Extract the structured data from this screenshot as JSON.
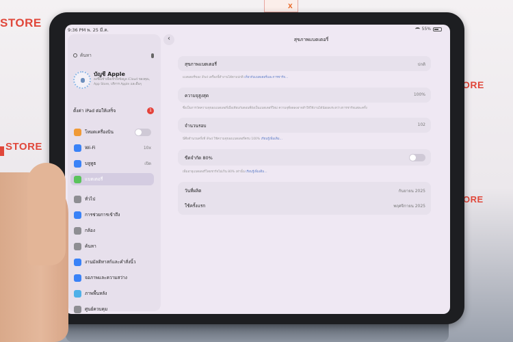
{
  "background": {
    "store_text_1": "STORE",
    "store_text_2": "STORE",
    "store_text_3": "ORE",
    "store_text_4": "ORE",
    "logo_letter": "x"
  },
  "status_bar": {
    "time": "9:36 PM  พ. 25 มี.ค.",
    "battery": "55%"
  },
  "sidebar": {
    "search_placeholder": "ค้นหา",
    "account": {
      "name": "บัญชี Apple",
      "subtitle": "ลงชื่อเข้าเพื่อเข้าถึงข้อมูล iCloud ของคุณ, App Store, บริการ Apple และอื่นๆ"
    },
    "finish_setup": {
      "label": "ตั้งค่า iPad ต่อให้เสร็จ",
      "badge": "1"
    },
    "items": [
      {
        "label": "โหมดเครื่องบิน",
        "value": "",
        "color": "#f09a37",
        "toggle": true
      },
      {
        "label": "Wi-Fi",
        "value": "10x",
        "color": "#3a82f7"
      },
      {
        "label": "บลูทูธ",
        "value": "เปิด",
        "color": "#3a82f7"
      },
      {
        "label": "แบตเตอรี่",
        "value": "",
        "color": "#5ac35c",
        "active": true
      },
      {
        "label": "ทั่วไป",
        "value": "",
        "color": "#8e8e93"
      },
      {
        "label": "การช่วยการเข้าถึง",
        "value": "",
        "color": "#3a82f7"
      },
      {
        "label": "กล้อง",
        "value": "",
        "color": "#8e8e93"
      },
      {
        "label": "ค้นหา",
        "value": "",
        "color": "#8e8e93"
      },
      {
        "label": "งานมัลติทาสก์และคำสั่งนิ้ว",
        "value": "",
        "color": "#3a82f7"
      },
      {
        "label": "จอภาพและความสว่าง",
        "value": "",
        "color": "#3a82f7"
      },
      {
        "label": "ภาพพื้นหลัง",
        "value": "",
        "color": "#4fb0e8"
      },
      {
        "label": "ศูนย์ควบคุม",
        "value": "",
        "color": "#8e8e93"
      }
    ]
  },
  "main": {
    "title": "สุขภาพแบตเตอรี่",
    "health": {
      "label": "สุขภาพแบตเตอรี่",
      "value": "ปกติ",
      "footer": "แบตเตอรี่ของ iPad เครื่องนี้ทำงานได้ตามปกติ ",
      "footer_link": "เกี่ยวกับแบตเตอรี่และการชาร์จ..."
    },
    "max_capacity": {
      "label": "ความจุสูงสุด",
      "value": "100%",
      "footer": "ซึ่งเป็นการวัดความจุของแบตเตอรี่เมื่อเทียบกับตอนที่ยังเป็นแบตเตอรี่ใหม่ ความจุที่ลดลงอาจทำให้ใช้งานได้น้อยลงระหว่างการชาร์จแต่ละครั้ง"
    },
    "cycle_count": {
      "label": "จำนวนรอบ",
      "value": "102",
      "footer": "นี่คือจำนวนครั้งที่ iPad ใช้ความจุของแบตเตอรี่ครบ 100% ",
      "footer_link": "เรียนรู้เพิ่มเติม..."
    },
    "limit_80": {
      "label": "ขีดจำกัด 80%",
      "footer": "เพิ่มอายุแบตเตอรี่โดยชาร์จไม่เกิน 80% เท่านั้น ",
      "footer_link": "เรียนรู้เพิ่มเติม..."
    },
    "manufacture": {
      "label": "วันที่ผลิต",
      "value": "กันยายน 2025"
    },
    "first_use": {
      "label": "ใช้ครั้งแรก",
      "value": "พฤศจิกายน 2025"
    }
  }
}
